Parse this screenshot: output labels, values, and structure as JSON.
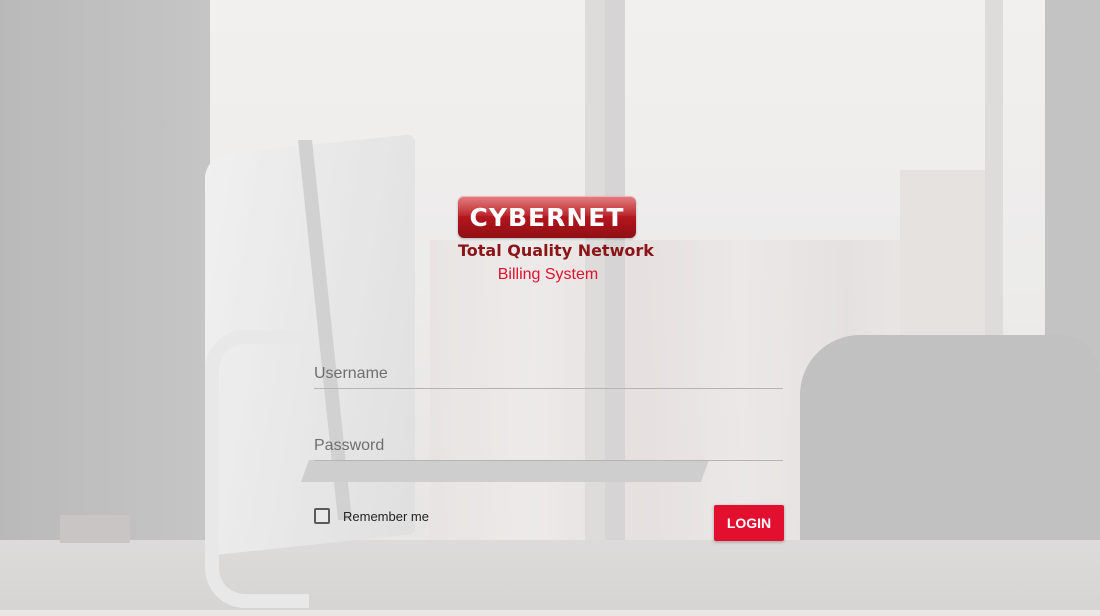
{
  "brand": {
    "logo_text": "CYBERNET",
    "tagline": "Total Quality Network",
    "subtitle": "Billing System",
    "colors": {
      "accent": "#e20f2f",
      "logo_red": "#b0151c",
      "tagline": "#8b1418"
    }
  },
  "form": {
    "username_placeholder": "Username",
    "password_placeholder": "Password",
    "remember_label": "Remember me",
    "remember_checked": false,
    "login_label": "LOGIN"
  }
}
